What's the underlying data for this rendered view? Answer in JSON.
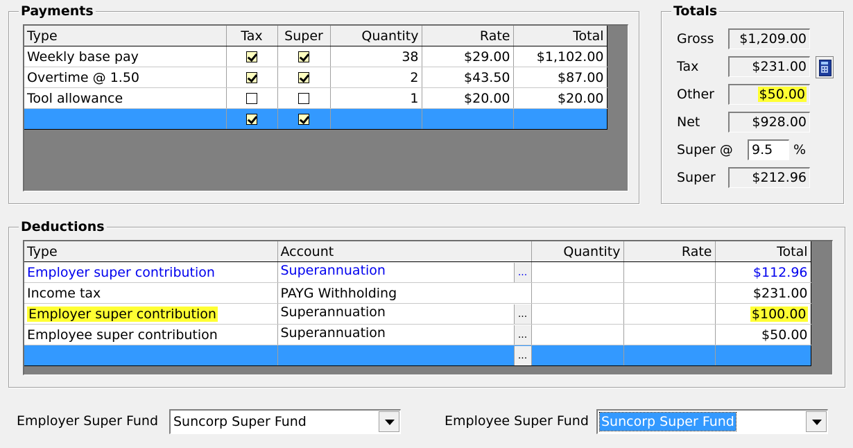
{
  "payments": {
    "title": "Payments",
    "columns": [
      "Type",
      "Tax",
      "Super",
      "Quantity",
      "Rate",
      "Total"
    ],
    "rows": [
      {
        "type": "Weekly base pay",
        "tax": true,
        "super": true,
        "quantity": "38",
        "rate": "$29.00",
        "total": "$1,102.00"
      },
      {
        "type": "Overtime @ 1.50",
        "tax": true,
        "super": true,
        "quantity": "2",
        "rate": "$43.50",
        "total": "$87.00"
      },
      {
        "type": "Tool allowance",
        "tax": false,
        "super": false,
        "quantity": "1",
        "rate": "$20.00",
        "total": "$20.00"
      }
    ],
    "new_row": {
      "tax": true,
      "super": true
    }
  },
  "totals": {
    "title": "Totals",
    "gross_label": "Gross",
    "gross_value": "$1,209.00",
    "tax_label": "Tax",
    "tax_value": "$231.00",
    "other_label": "Other",
    "other_value": "$50.00",
    "net_label": "Net",
    "net_value": "$928.00",
    "super_rate_label": "Super @",
    "super_rate_value": "9.5",
    "super_rate_unit": "%",
    "super_label": "Super",
    "super_value": "$212.96"
  },
  "deductions": {
    "title": "Deductions",
    "columns": [
      "Type",
      "Account",
      "Quantity",
      "Rate",
      "Total"
    ],
    "ellipsis": "...",
    "rows": [
      {
        "type": "Employer super contribution",
        "account": "Superannuation",
        "quantity": "",
        "rate": "",
        "total": "$112.96"
      },
      {
        "type": "Income tax",
        "account": "PAYG Withholding",
        "quantity": "",
        "rate": "",
        "total": "$231.00"
      },
      {
        "type": "Employer super contribution",
        "account": "Superannuation",
        "quantity": "",
        "rate": "",
        "total": "$100.00"
      },
      {
        "type": "Employee super contribution",
        "account": "Superannuation",
        "quantity": "",
        "rate": "",
        "total": "$50.00"
      }
    ]
  },
  "funds": {
    "employer_label": "Employer Super Fund",
    "employer_value": "Suncorp Super Fund",
    "employee_label": "Employee Super Fund",
    "employee_value": "Suncorp Super Fund"
  },
  "colors": {
    "selection_blue": "#3399ff",
    "highlight_yellow": "#ffff33",
    "link_blue": "#0000ee",
    "grid_gray": "#808080"
  }
}
